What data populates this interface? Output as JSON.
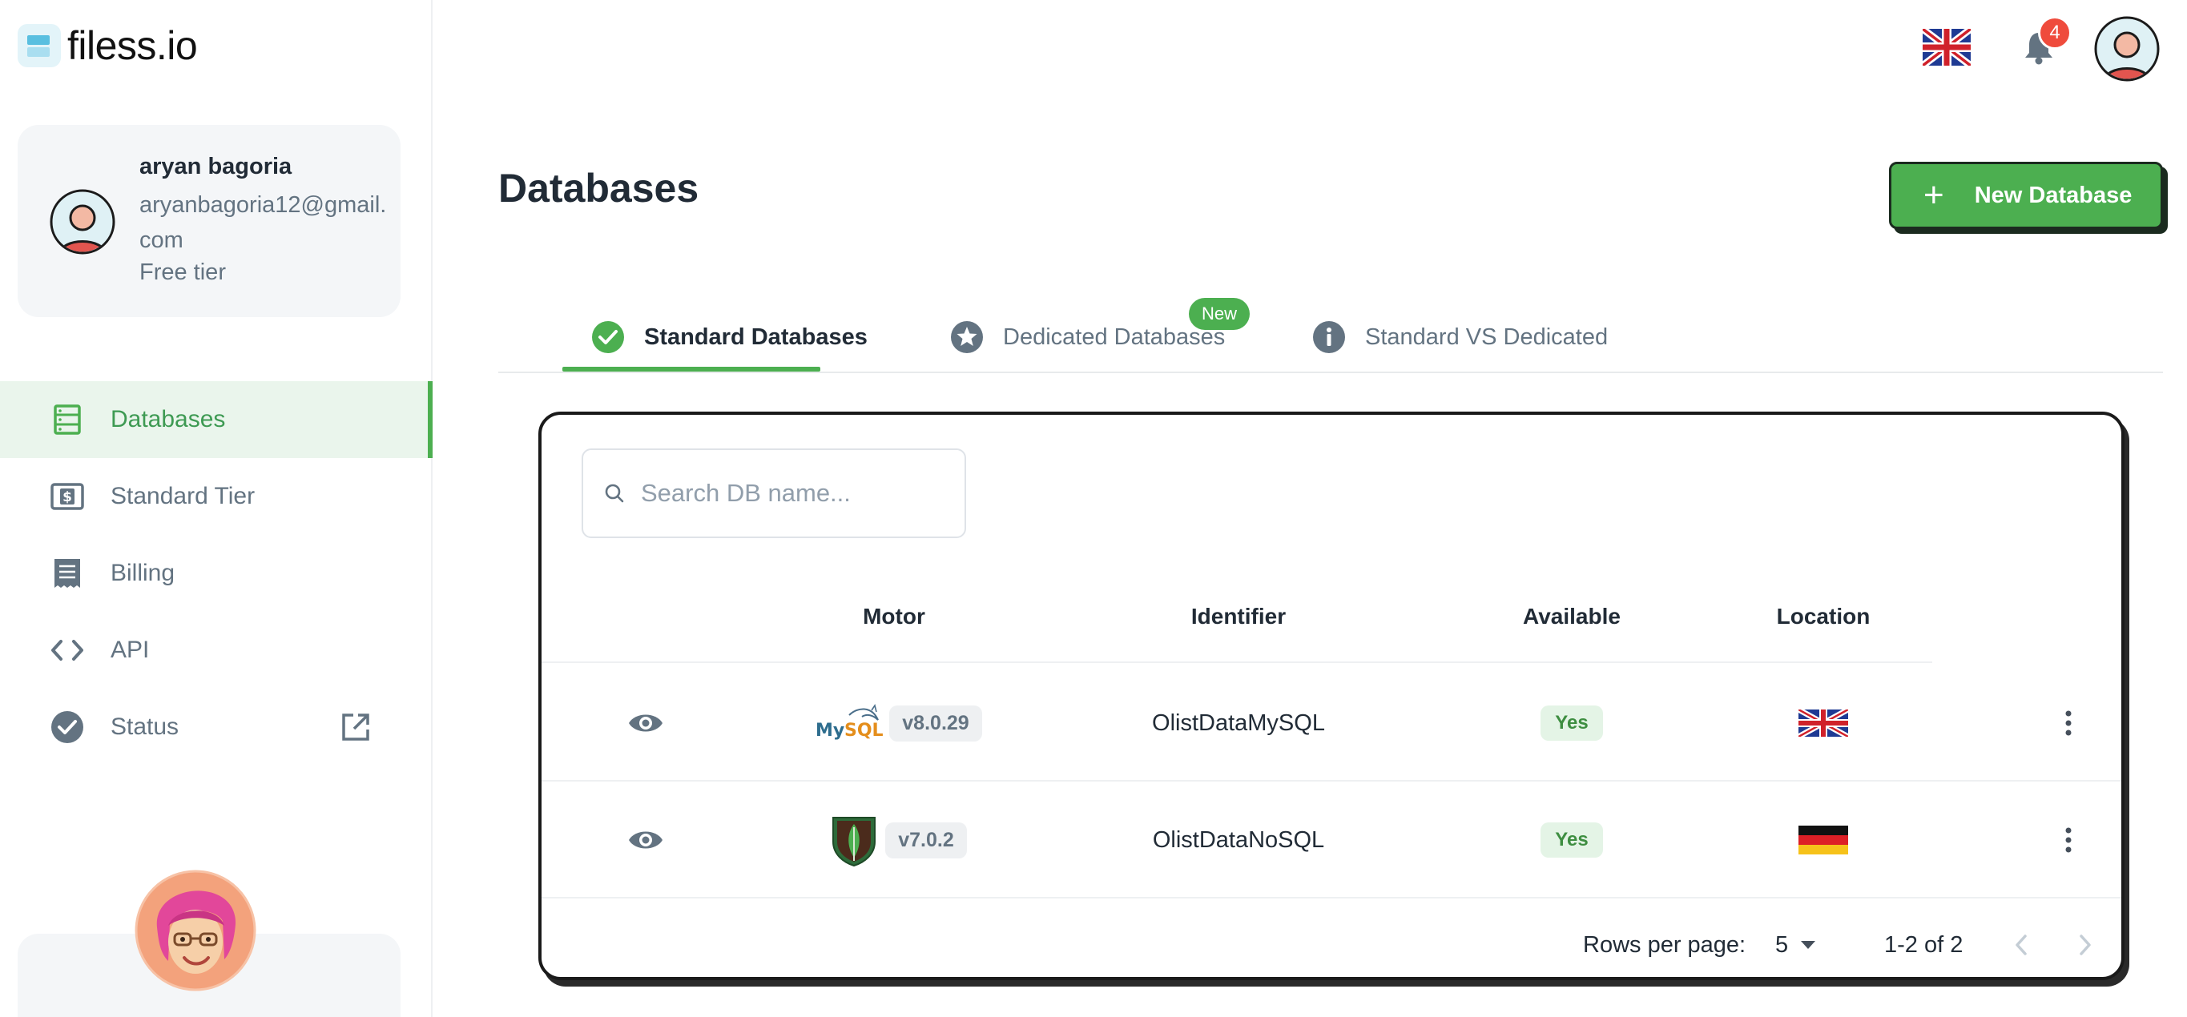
{
  "app": {
    "logo_text": "filess.io"
  },
  "user": {
    "name": "aryan bagoria",
    "email": "aryanbagoria12@gmail.com",
    "tier": "Free tier"
  },
  "sidebar": {
    "items": [
      {
        "label": "Databases",
        "icon": "database-icon",
        "active": true
      },
      {
        "label": "Standard Tier",
        "icon": "dollar-bill-icon",
        "active": false
      },
      {
        "label": "Billing",
        "icon": "receipt-icon",
        "active": false
      },
      {
        "label": "API",
        "icon": "code-icon",
        "active": false
      },
      {
        "label": "Status",
        "icon": "check-circle-icon",
        "active": false
      }
    ]
  },
  "topbar": {
    "notification_count": "4",
    "language_flag": "uk-flag-icon"
  },
  "page": {
    "title": "Databases",
    "new_button_label": "New Database"
  },
  "tabs": [
    {
      "label": "Standard Databases",
      "icon": "check-circle-icon",
      "active": true
    },
    {
      "label": "Dedicated Databases",
      "icon": "star-circle-icon",
      "badge": "New"
    },
    {
      "label": "Standard VS Dedicated",
      "icon": "info-circle-icon"
    }
  ],
  "search": {
    "placeholder": "Search DB name..."
  },
  "table": {
    "columns": [
      "Motor",
      "Identifier",
      "Available",
      "Location"
    ],
    "rows": [
      {
        "engine": "MySQL",
        "version": "v8.0.29",
        "identifier": "OlistDataMySQL",
        "available": "Yes",
        "location": "uk-flag-icon"
      },
      {
        "engine": "MongoDB",
        "version": "v7.0.2",
        "identifier": "OlistDataNoSQL",
        "available": "Yes",
        "location": "germany-flag-icon"
      }
    ],
    "pagination": {
      "rows_per_page_label": "Rows per page:",
      "rows_per_page": "5",
      "range": "1-2 of 2"
    }
  },
  "colors": {
    "accent": "#4caf50",
    "badge": "#ef4b3c"
  }
}
